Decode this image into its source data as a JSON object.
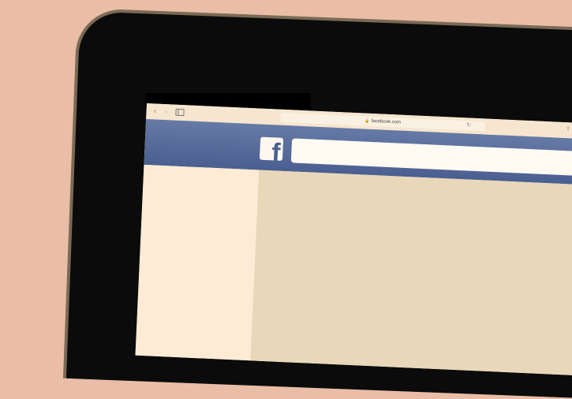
{
  "browser": {
    "back_icon": "‹",
    "forward_icon": "›",
    "url": "facebook.com",
    "lock_icon": "🔒",
    "reload_icon": "↻",
    "share_icon": "⇧",
    "new_tab_icon": "+"
  },
  "facebook": {
    "logo": "f",
    "search": {
      "placeholder": ""
    },
    "brand_color": "#4a5f91"
  }
}
